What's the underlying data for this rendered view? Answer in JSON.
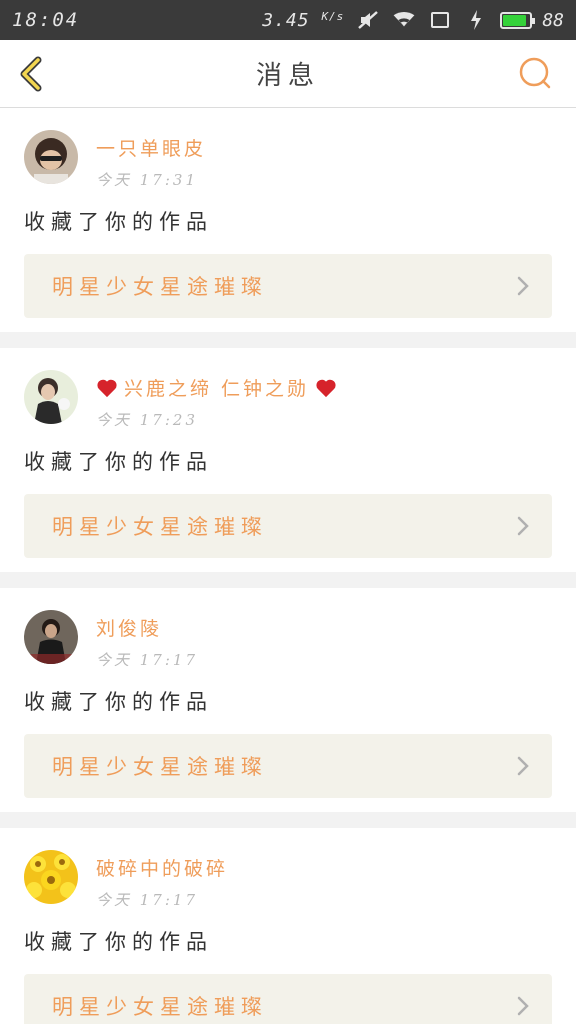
{
  "status_bar": {
    "time": "18:04",
    "speed": "3.45",
    "speed_unit": "K/s",
    "battery": "88",
    "battery_fraction": 0.88
  },
  "header": {
    "title": "消息",
    "back_icon": "back-chevron-icon",
    "search_icon": "search-icon"
  },
  "accent_color": "#ef9d5a",
  "messages": [
    {
      "name": "一只单眼皮",
      "time": "今天  17:31",
      "action": "收藏了你的作品",
      "work": "明星少女星途璀璨",
      "has_hearts": false
    },
    {
      "name": "兴鹿之缔 仁钟之勋",
      "time": "今天  17:23",
      "action": "收藏了你的作品",
      "work": "明星少女星途璀璨",
      "has_hearts": true
    },
    {
      "name": "刘俊陵",
      "time": "今天  17:17",
      "action": "收藏了你的作品",
      "work": "明星少女星途璀璨",
      "has_hearts": false
    },
    {
      "name": "破碎中的破碎",
      "time": "今天  17:17",
      "action": "收藏了你的作品",
      "work": "明星少女星途璀璨",
      "has_hearts": false
    }
  ]
}
